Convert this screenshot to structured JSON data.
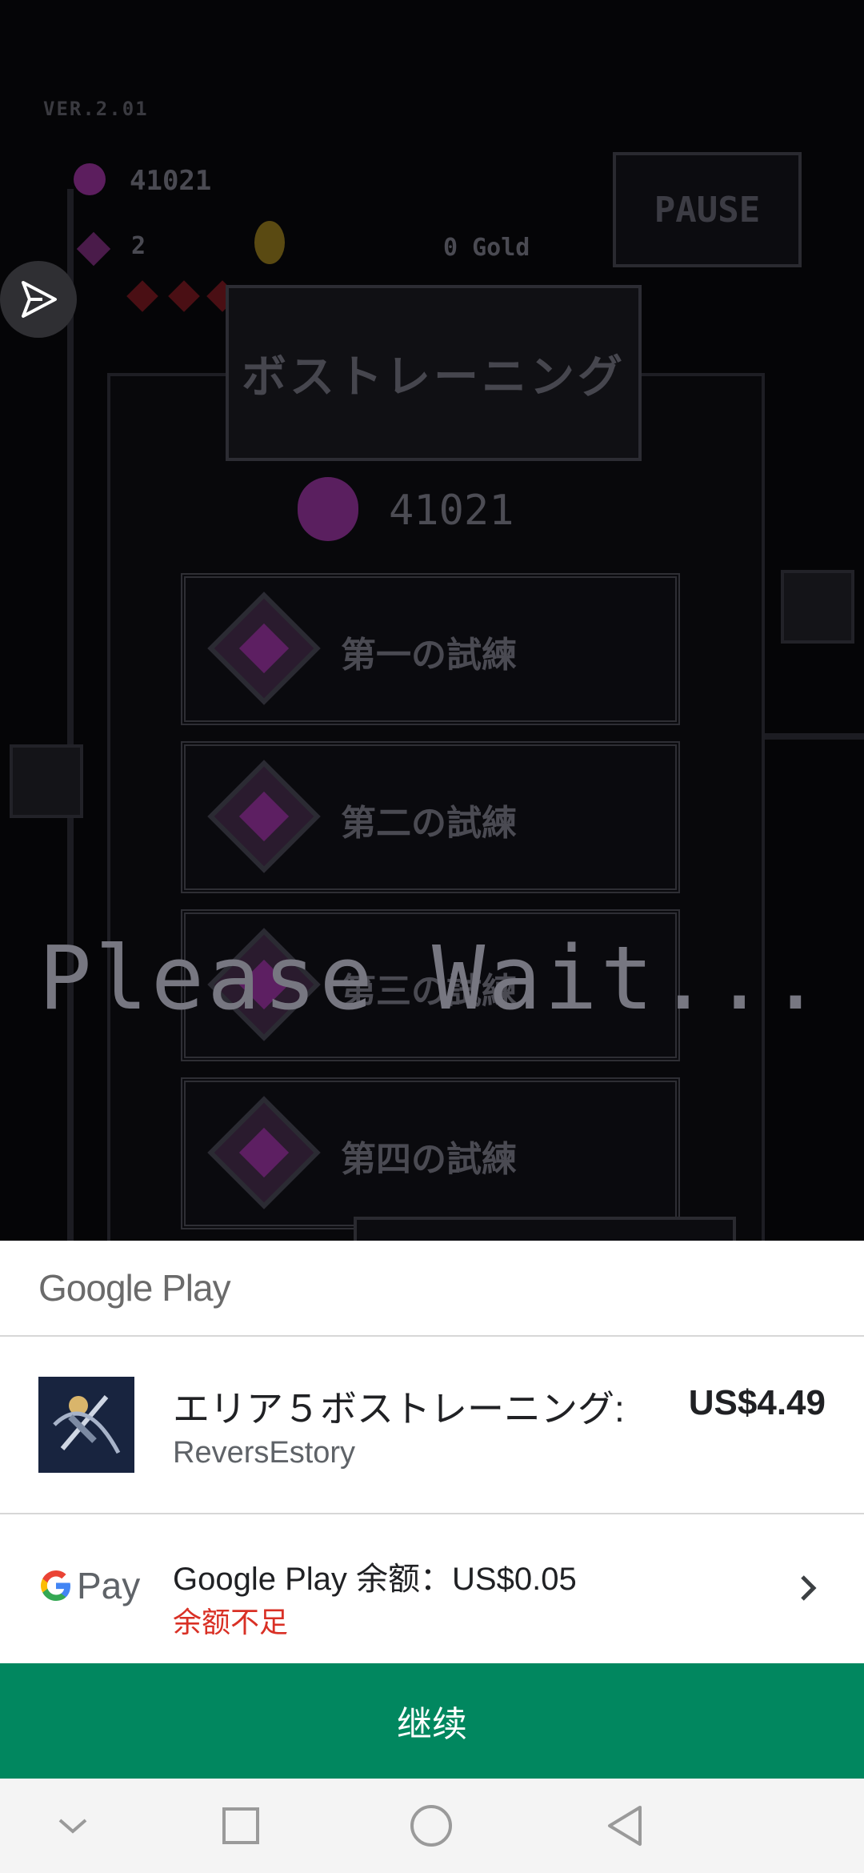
{
  "game": {
    "version": "VER.2.01",
    "potions": "41021",
    "gems": "2",
    "gold": "0 Gold",
    "pause_label": "PAUSE",
    "title": "ボストレーニング",
    "potion_count": "41021",
    "trials": [
      "第一の試練",
      "第二の試練",
      "第三の試練",
      "第四の試練"
    ],
    "wait_text": "Please Wait..."
  },
  "purchase_sheet": {
    "brand": "Google Play",
    "item": {
      "title": "エリア５ボストレーニング:",
      "developer": "ReversEstory",
      "price": "US$4.49"
    },
    "payment": {
      "method_logo": "Pay",
      "balance_label": "Google Play 余额：US$0.05",
      "warning": "余额不足"
    },
    "continue_label": "继续"
  },
  "colors": {
    "continue_bg": "#01875f",
    "warning": "#d93025"
  },
  "nav": {
    "icons": [
      "chevron-down-icon",
      "square-icon",
      "circle-icon",
      "back-triangle-icon"
    ]
  }
}
